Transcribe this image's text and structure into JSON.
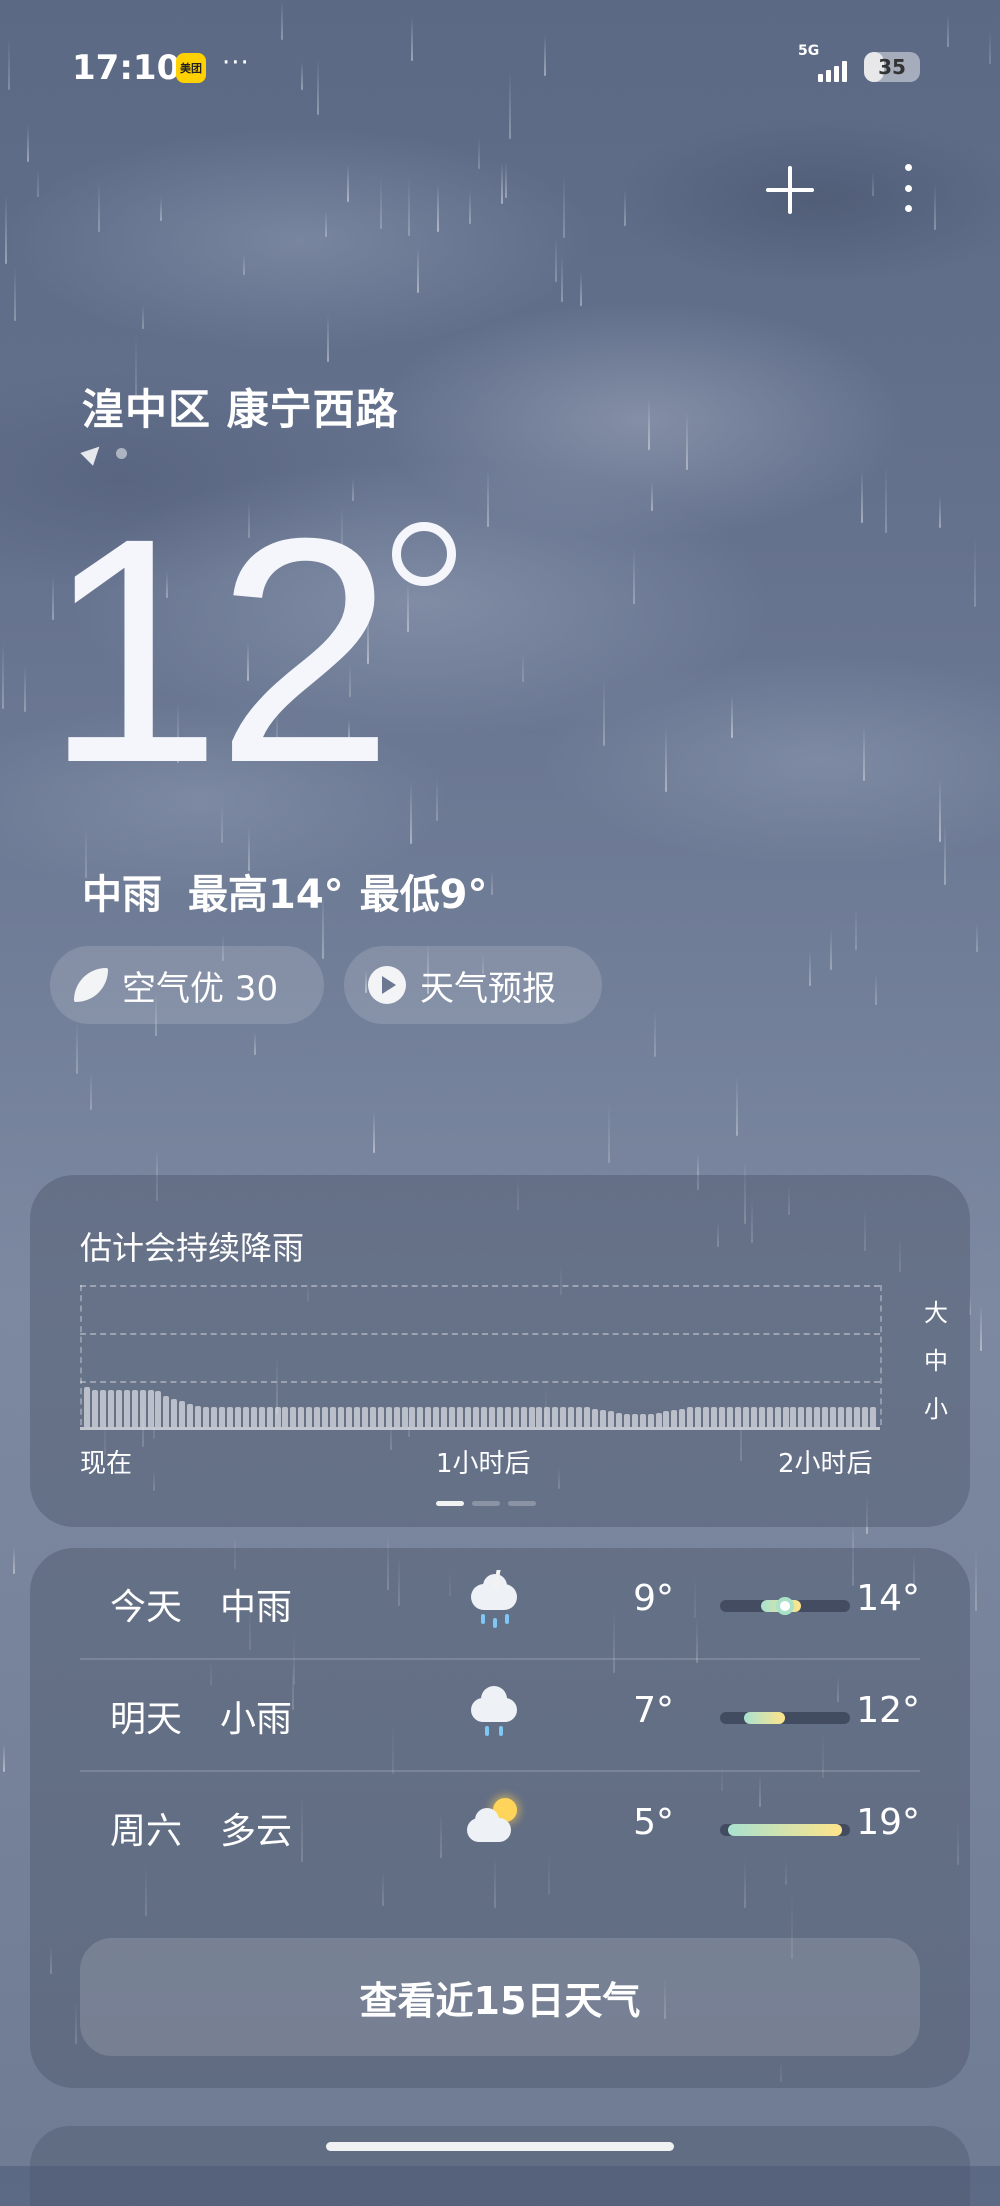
{
  "status_bar": {
    "time": "17:10",
    "app_badge": "美团",
    "more": "···",
    "network": "5G",
    "battery": "35",
    "battery_level": 0.35
  },
  "top_actions": {
    "add_icon": "plus-icon",
    "more_icon": "more-vertical-icon"
  },
  "location": {
    "name": "湟中区 康宁西路"
  },
  "current": {
    "temperature": "12",
    "condition": "中雨",
    "high": "最高14°",
    "low": "最低9°"
  },
  "chips": {
    "air_quality": "空气优 30",
    "forecast_video": "天气预报"
  },
  "rain_card": {
    "title": "估计会持续降雨",
    "levels": [
      "大",
      "中",
      "小"
    ],
    "ticks": [
      "现在",
      "1小时后",
      "2小时后"
    ],
    "intensity": [
      0.28,
      0.26,
      0.26,
      0.26,
      0.26,
      0.26,
      0.26,
      0.26,
      0.26,
      0.25,
      0.22,
      0.2,
      0.18,
      0.16,
      0.15,
      0.14,
      0.14,
      0.14,
      0.14,
      0.14,
      0.14,
      0.14,
      0.14,
      0.14,
      0.14,
      0.14,
      0.14,
      0.14,
      0.14,
      0.14,
      0.14,
      0.14,
      0.14,
      0.14,
      0.14,
      0.14,
      0.14,
      0.14,
      0.14,
      0.14,
      0.14,
      0.14,
      0.14,
      0.14,
      0.14,
      0.14,
      0.14,
      0.14,
      0.14,
      0.14,
      0.14,
      0.14,
      0.14,
      0.14,
      0.14,
      0.14,
      0.14,
      0.14,
      0.14,
      0.14,
      0.14,
      0.14,
      0.14,
      0.14,
      0.13,
      0.12,
      0.11,
      0.1,
      0.09,
      0.09,
      0.09,
      0.09,
      0.1,
      0.11,
      0.12,
      0.13,
      0.14,
      0.14,
      0.14,
      0.14,
      0.14,
      0.14,
      0.14,
      0.14,
      0.14,
      0.14,
      0.14,
      0.14,
      0.14,
      0.14,
      0.14,
      0.14,
      0.14,
      0.14,
      0.14,
      0.14,
      0.14,
      0.14,
      0.14,
      0.14
    ],
    "pages": 3,
    "active_page": 0
  },
  "forecast": {
    "days": [
      {
        "day": "今天",
        "condition": "中雨",
        "icon": "cloud-rain-lightning-icon",
        "low": "9°",
        "high": "14°",
        "low_value": 9,
        "high_value": 14,
        "current_marker": true
      },
      {
        "day": "明天",
        "condition": "小雨",
        "icon": "cloud-rain-icon",
        "low": "7°",
        "high": "12°",
        "low_value": 7,
        "high_value": 12,
        "current_marker": false
      },
      {
        "day": "周六",
        "condition": "多云",
        "icon": "partly-cloudy-icon",
        "low": "5°",
        "high": "19°",
        "low_value": 5,
        "high_value": 19,
        "current_marker": false
      }
    ],
    "range_min": 4,
    "range_max": 20,
    "button_label": "查看近15日天气"
  },
  "colors": {
    "range_gradient_start": "#a9e2d0",
    "range_gradient_end": "#ffe48a",
    "badge": "#ffd100"
  }
}
